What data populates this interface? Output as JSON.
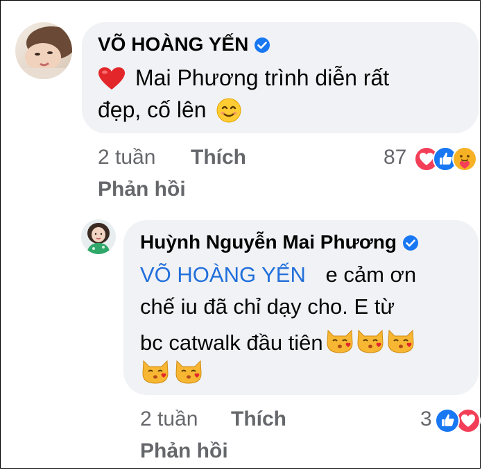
{
  "comment": {
    "author": "VÕ HOÀNG YẾN",
    "text_line_1": "Mai Phương trình diễn rất",
    "text_line_2": "đẹp, cố lên",
    "time": "2 tuần",
    "like_label": "Thích",
    "reply_label": "Phản hồi",
    "reaction_count": "87",
    "icons": [
      "red-heart-emoji",
      "smiling-emoji",
      "heart-reaction-icon",
      "like-reaction-icon",
      "care-reaction-icon",
      "verified-badge-icon"
    ]
  },
  "reply": {
    "author": "Huỳnh Nguyễn Mai Phương",
    "mention": "VÕ HOÀNG YẾN",
    "text_line_1_rest": "e cảm ơn",
    "text_line_2": "chế iu đã chỉ dạy cho. E từ",
    "text_line_3": "bc catwalk đầu tiên",
    "time": "2 tuần",
    "like_label": "Thích",
    "reply_label": "Phản hồi",
    "reaction_count": "3",
    "icons": [
      "kissing-cat-emoji",
      "like-reaction-icon",
      "heart-reaction-icon",
      "verified-badge-icon"
    ]
  },
  "colors": {
    "bubble": "#f0f2f5",
    "mention": "#216fdb",
    "meta": "#65676b",
    "verified": "#1877f2"
  }
}
